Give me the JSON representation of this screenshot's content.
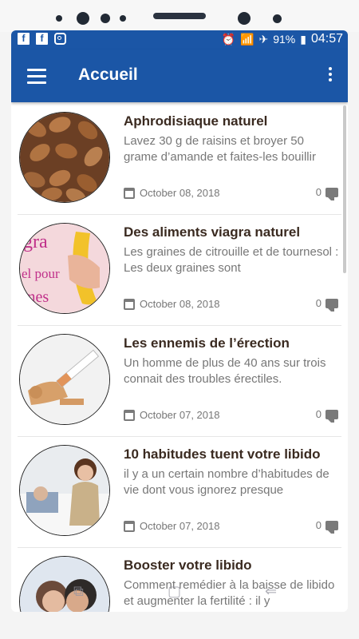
{
  "statusbar": {
    "icons_left": [
      "facebook-icon",
      "facebook-icon",
      "instagram-icon"
    ],
    "battery": "91%",
    "time": "04:57"
  },
  "appbar": {
    "title": "Accueil"
  },
  "articles": [
    {
      "title": "Aphrodisiaque naturel",
      "desc": "Lavez 30 g de raisins et broyer 50 grame d’amande et faites-les bouillir",
      "date": "October 08, 2018",
      "comments": "0"
    },
    {
      "title": "Des aliments viagra naturel",
      "desc": "Les graines de citrouille et de tournesol : Les deux graines sont",
      "date": "October 08, 2018",
      "comments": "0"
    },
    {
      "title": "Les ennemis de l’érection",
      "desc": "Un homme de plus de 40 ans sur trois connait des troubles érectiles.",
      "date": "October 07, 2018",
      "comments": "0"
    },
    {
      "title": "10 habitudes tuent votre libido",
      "desc": "il y a un certain nombre d’habitudes de vie dont vous ignorez presque",
      "date": "October 07, 2018",
      "comments": "0"
    },
    {
      "title": "Booster votre libido",
      "desc": "Comment remédier à la baisse de libido et augmenter la fertilité : il y",
      "date": "",
      "comments": ""
    }
  ],
  "colors": {
    "primary": "#1b56a6",
    "title_text": "#3a2a20",
    "meta_text": "#777777"
  }
}
